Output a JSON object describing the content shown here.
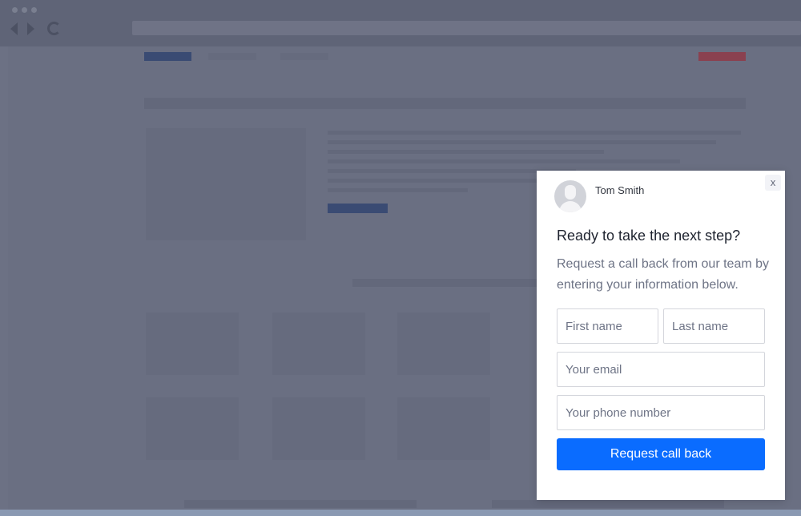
{
  "modal": {
    "agent_name": "Tom Smith",
    "close_label": "x",
    "headline": "Ready to take the next step?",
    "subtext": "Request a call back from our team by entering your information below.",
    "fields": {
      "first_name": {
        "value": "",
        "placeholder": "First name"
      },
      "last_name": {
        "value": "",
        "placeholder": "Last name"
      },
      "email": {
        "value": "",
        "placeholder": "Your email"
      },
      "phone": {
        "value": "",
        "placeholder": "Your phone number"
      }
    },
    "submit_label": "Request call back",
    "accent_color": "#0a6cff"
  },
  "icons": {
    "avatar": "user-silhouette-icon",
    "back": "back-arrow-icon",
    "forward": "forward-arrow-icon",
    "reload": "reload-icon"
  }
}
